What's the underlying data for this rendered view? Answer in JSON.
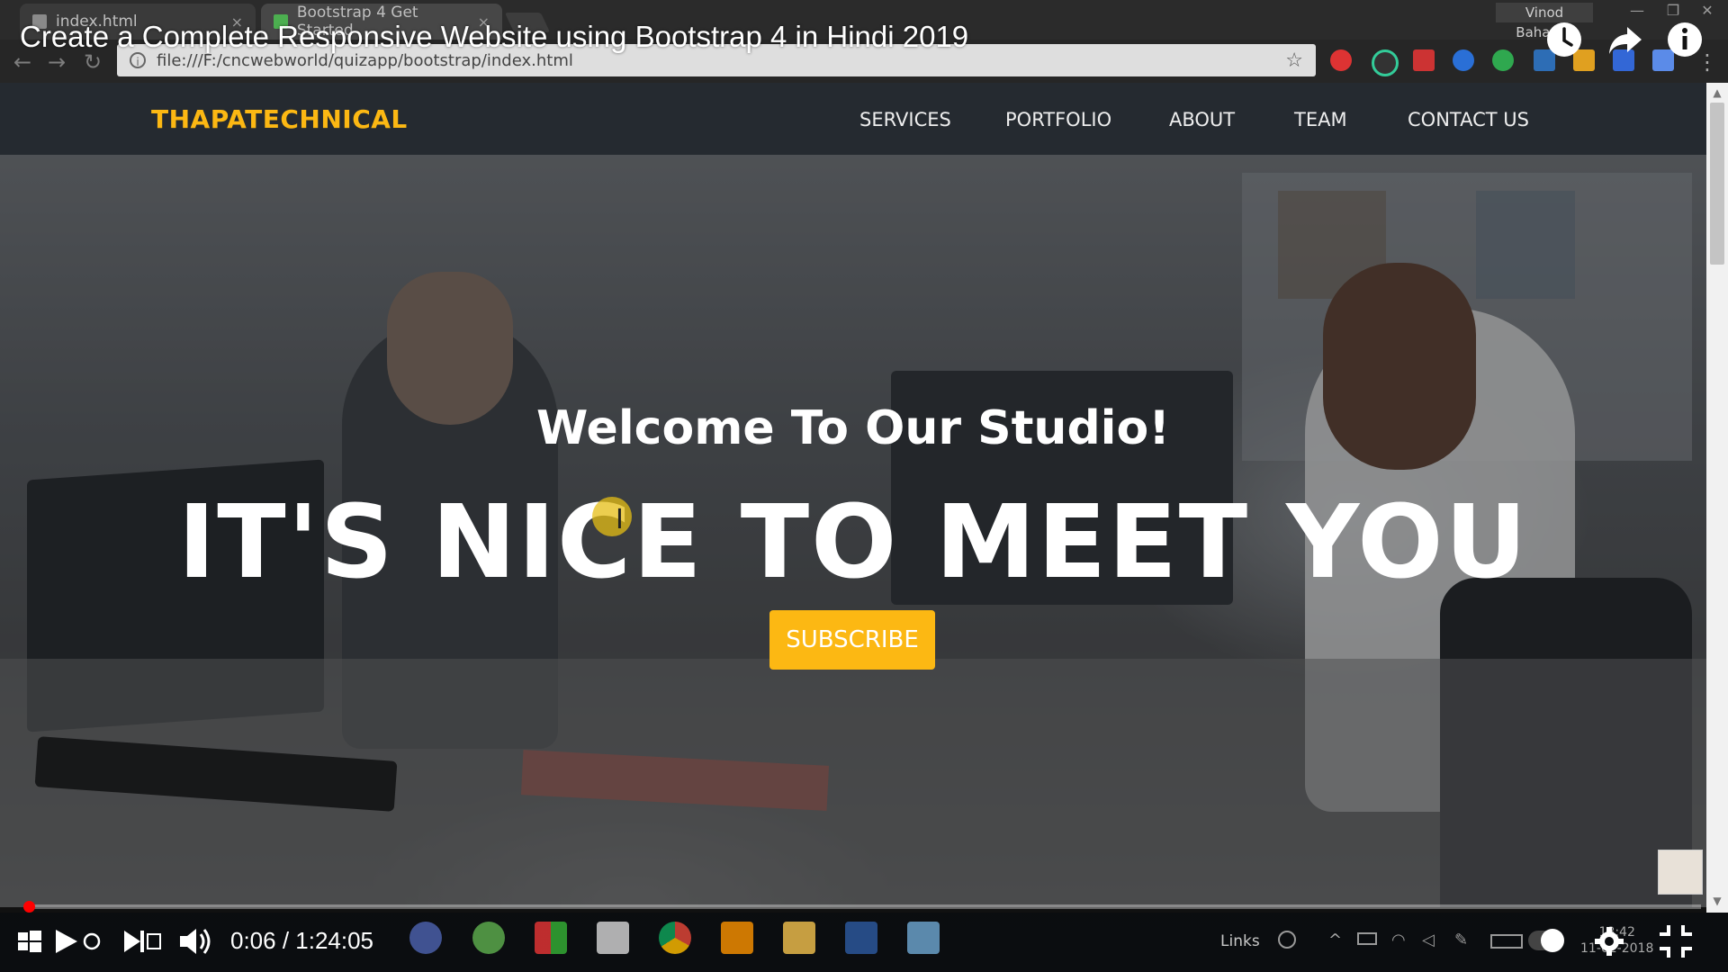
{
  "browser": {
    "tabs": [
      {
        "label": "index.html",
        "close": "×"
      },
      {
        "label": "Bootstrap 4 Get Started",
        "close": "×"
      }
    ],
    "user": "Vinod Bahadur",
    "window_controls": [
      "—",
      "❐",
      "✕"
    ],
    "url": "file:///F:/cncwebworld/quizapp/bootstrap/index.html",
    "nav_icons": [
      "back-arrow-icon",
      "forward-arrow-icon",
      "reload-icon"
    ],
    "star_icon": "☆"
  },
  "site": {
    "brand": "THAPATECHNICAL",
    "nav": [
      "SERVICES",
      "PORTFOLIO",
      "ABOUT",
      "TEAM",
      "CONTACT US"
    ],
    "welcome": "Welcome To Our Studio!",
    "headline": "IT'S NICE TO MEET YOU",
    "cta": "SUBSCRIBE",
    "accent": "#fcb813"
  },
  "video": {
    "title": "Create a Complete Responsive Website using Bootstrap 4 in Hindi 2019",
    "time": "0:06 / 1:24:05",
    "progress": 0.0012,
    "top_icons": [
      "clock-icon",
      "share-icon",
      "info-icon"
    ]
  },
  "taskbar": {
    "links_label": "Links",
    "clock_time": "18:42",
    "clock_date": "11-02-2018"
  }
}
